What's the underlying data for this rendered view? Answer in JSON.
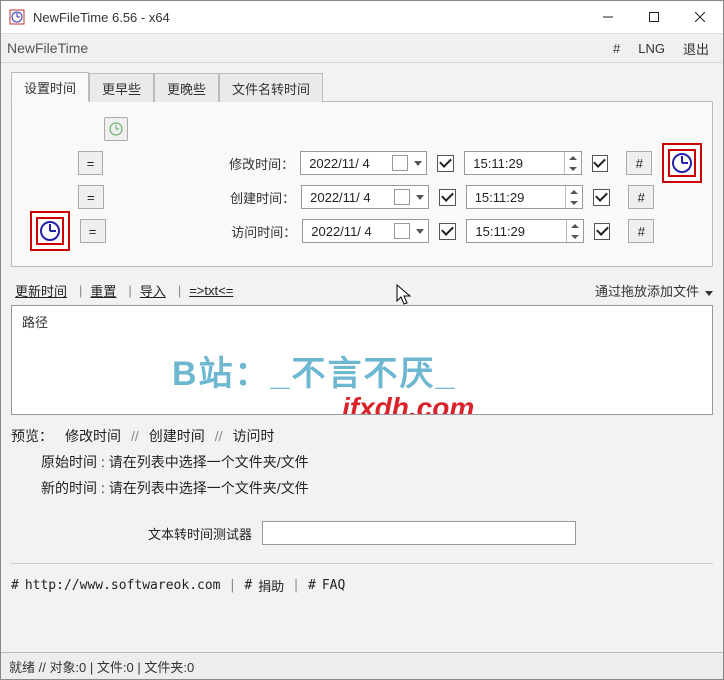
{
  "title": "NewFileTime 6.56 - x64",
  "app_name": "NewFileTime",
  "menubar": {
    "hash": "#",
    "lng": "LNG",
    "exit": "退出"
  },
  "tabs": [
    "设置时间",
    "更早些",
    "更晚些",
    "文件名转时间"
  ],
  "row_labels": {
    "modified": "修改时间：",
    "created": "创建时间：",
    "accessed": "访问时间："
  },
  "eq_symbol": "=",
  "hash_symbol": "#",
  "date_value": "2022/11/ 4",
  "time_value": "15:11:29",
  "actions": {
    "update": "更新时间",
    "reset": "重置",
    "import": "导入",
    "txt": "=>txt<=",
    "drop_hint": "通过拖放添加文件"
  },
  "filelist": {
    "col_path": "路径"
  },
  "watermarks": {
    "w1": "B站：_不言不厌_",
    "w2": "ifxdh.com"
  },
  "preview": {
    "label": "预览：",
    "cols": [
      "修改时间",
      "创建时间",
      "访问时"
    ],
    "sep": "//",
    "orig_label": "原始时间 :",
    "new_label": "新的时间 :",
    "placeholder": "请在列表中选择一个文件夹/文件"
  },
  "tester": {
    "label": "文本转时间测试器",
    "value": ""
  },
  "links": {
    "hash": "#",
    "url": "http://www.softwareok.com",
    "donate": "捐助",
    "faq": "FAQ"
  },
  "status": "就绪  //  对象:0  |  文件:0  |  文件夹:0"
}
